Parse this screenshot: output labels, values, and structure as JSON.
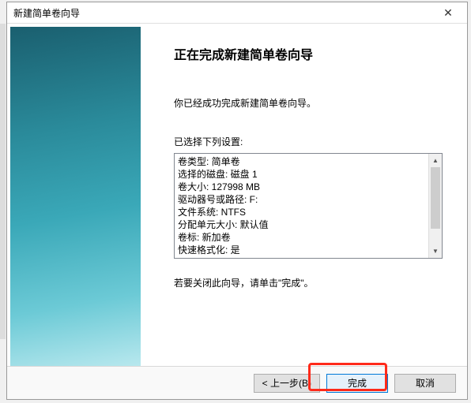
{
  "window": {
    "title": "新建简单卷向导"
  },
  "wizard": {
    "heading": "正在完成新建简单卷向导",
    "description": "你已经成功完成新建简单卷向导。",
    "settings_label": "已选择下列设置:",
    "settings": [
      "卷类型: 简单卷",
      "选择的磁盘: 磁盘 1",
      "卷大小: 127998 MB",
      "驱动器号或路径: F:",
      "文件系统: NTFS",
      "分配单元大小: 默认值",
      "卷标: 新加卷",
      "快速格式化: 是"
    ],
    "close_hint": "若要关闭此向导，请单击\"完成\"。"
  },
  "buttons": {
    "back": "< 上一步(B)",
    "finish": "完成",
    "cancel": "取消"
  }
}
